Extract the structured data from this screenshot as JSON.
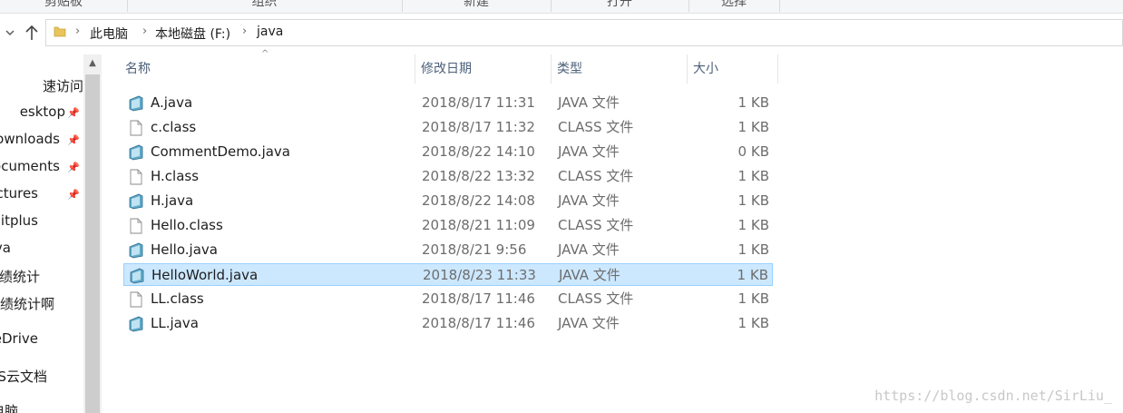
{
  "ribbon": {
    "groups": [
      "剪贴板",
      "组织",
      "新建",
      "打开",
      "选择"
    ]
  },
  "address": {
    "crumbs": [
      "此电脑",
      "本地磁盘 (F:)",
      "java"
    ]
  },
  "navpane": {
    "items": [
      {
        "label": "速访问",
        "pinned": false
      },
      {
        "label": "esktop",
        "pinned": true
      },
      {
        "label": "ownloads",
        "pinned": true
      },
      {
        "label": "ocuments",
        "pinned": true
      },
      {
        "label": "ctures",
        "pinned": true
      },
      {
        "label": "litplus",
        "pinned": false
      },
      {
        "label": "va",
        "pinned": false
      },
      {
        "label": "绩统计",
        "pinned": false
      },
      {
        "label": "绩统计啊",
        "pinned": false
      },
      {
        "label": "eDrive",
        "pinned": false
      },
      {
        "label": "S云文档",
        "pinned": false
      },
      {
        "label": "电脑",
        "pinned": false
      }
    ]
  },
  "columns": {
    "name": "名称",
    "date": "修改日期",
    "type": "类型",
    "size": "大小"
  },
  "files": [
    {
      "name": "A.java",
      "date": "2018/8/17 11:31",
      "type": "JAVA 文件",
      "size": "1 KB",
      "icon": "java-file-icon"
    },
    {
      "name": "c.class",
      "date": "2018/8/17 11:32",
      "type": "CLASS 文件",
      "size": "1 KB",
      "icon": "class-file-icon"
    },
    {
      "name": "CommentDemo.java",
      "date": "2018/8/22 14:10",
      "type": "JAVA 文件",
      "size": "0 KB",
      "icon": "java-file-icon"
    },
    {
      "name": "H.class",
      "date": "2018/8/22 13:32",
      "type": "CLASS 文件",
      "size": "1 KB",
      "icon": "class-file-icon"
    },
    {
      "name": "H.java",
      "date": "2018/8/22 14:08",
      "type": "JAVA 文件",
      "size": "1 KB",
      "icon": "java-file-icon"
    },
    {
      "name": "Hello.class",
      "date": "2018/8/21 11:09",
      "type": "CLASS 文件",
      "size": "1 KB",
      "icon": "class-file-icon"
    },
    {
      "name": "Hello.java",
      "date": "2018/8/21 9:56",
      "type": "JAVA 文件",
      "size": "1 KB",
      "icon": "java-file-icon"
    },
    {
      "name": "HelloWorld.java",
      "date": "2018/8/23 11:33",
      "type": "JAVA 文件",
      "size": "1 KB",
      "icon": "java-file-icon",
      "selected": true
    },
    {
      "name": "LL.class",
      "date": "2018/8/17 11:46",
      "type": "CLASS 文件",
      "size": "1 KB",
      "icon": "class-file-icon"
    },
    {
      "name": "LL.java",
      "date": "2018/8/17 11:46",
      "type": "JAVA 文件",
      "size": "1 KB",
      "icon": "java-file-icon"
    }
  ],
  "watermark": "https://blog.csdn.net/SirLiu_",
  "colors": {
    "selection_bg": "#cce8ff",
    "selection_border": "#99d1ff",
    "header_text": "#4c607a"
  }
}
